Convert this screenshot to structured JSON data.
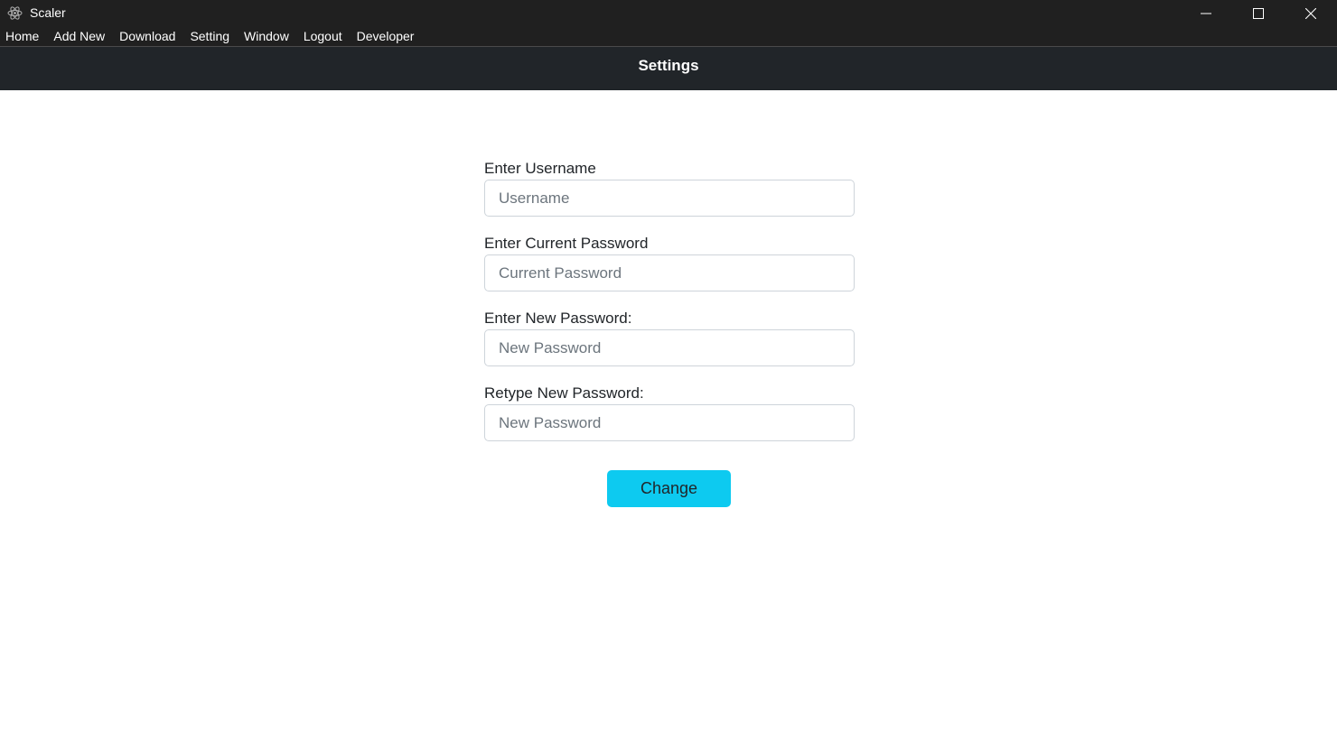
{
  "window": {
    "title": "Scaler",
    "icon": "electron-atom-icon",
    "controls": [
      "minimize-icon",
      "maximize-icon",
      "close-icon"
    ]
  },
  "menu": {
    "items": [
      "Home",
      "Add New",
      "Download",
      "Setting",
      "Window",
      "Logout",
      "Developer"
    ]
  },
  "header": {
    "title": "Settings"
  },
  "form": {
    "username": {
      "label": "Enter Username",
      "placeholder": "Username",
      "value": ""
    },
    "current_password": {
      "label": "Enter Current Password",
      "placeholder": "Current Password",
      "value": ""
    },
    "new_password": {
      "label": "Enter New Password:",
      "placeholder": "New Password",
      "value": ""
    },
    "retype_password": {
      "label": "Retype New Password:",
      "placeholder": "New Password",
      "value": ""
    },
    "submit_label": "Change"
  },
  "colors": {
    "titlebar": "#202020",
    "header": "#212529",
    "accent": "#0dcaf0",
    "text": "#212529",
    "input_border": "#ced4da",
    "placeholder": "#6c757d"
  }
}
